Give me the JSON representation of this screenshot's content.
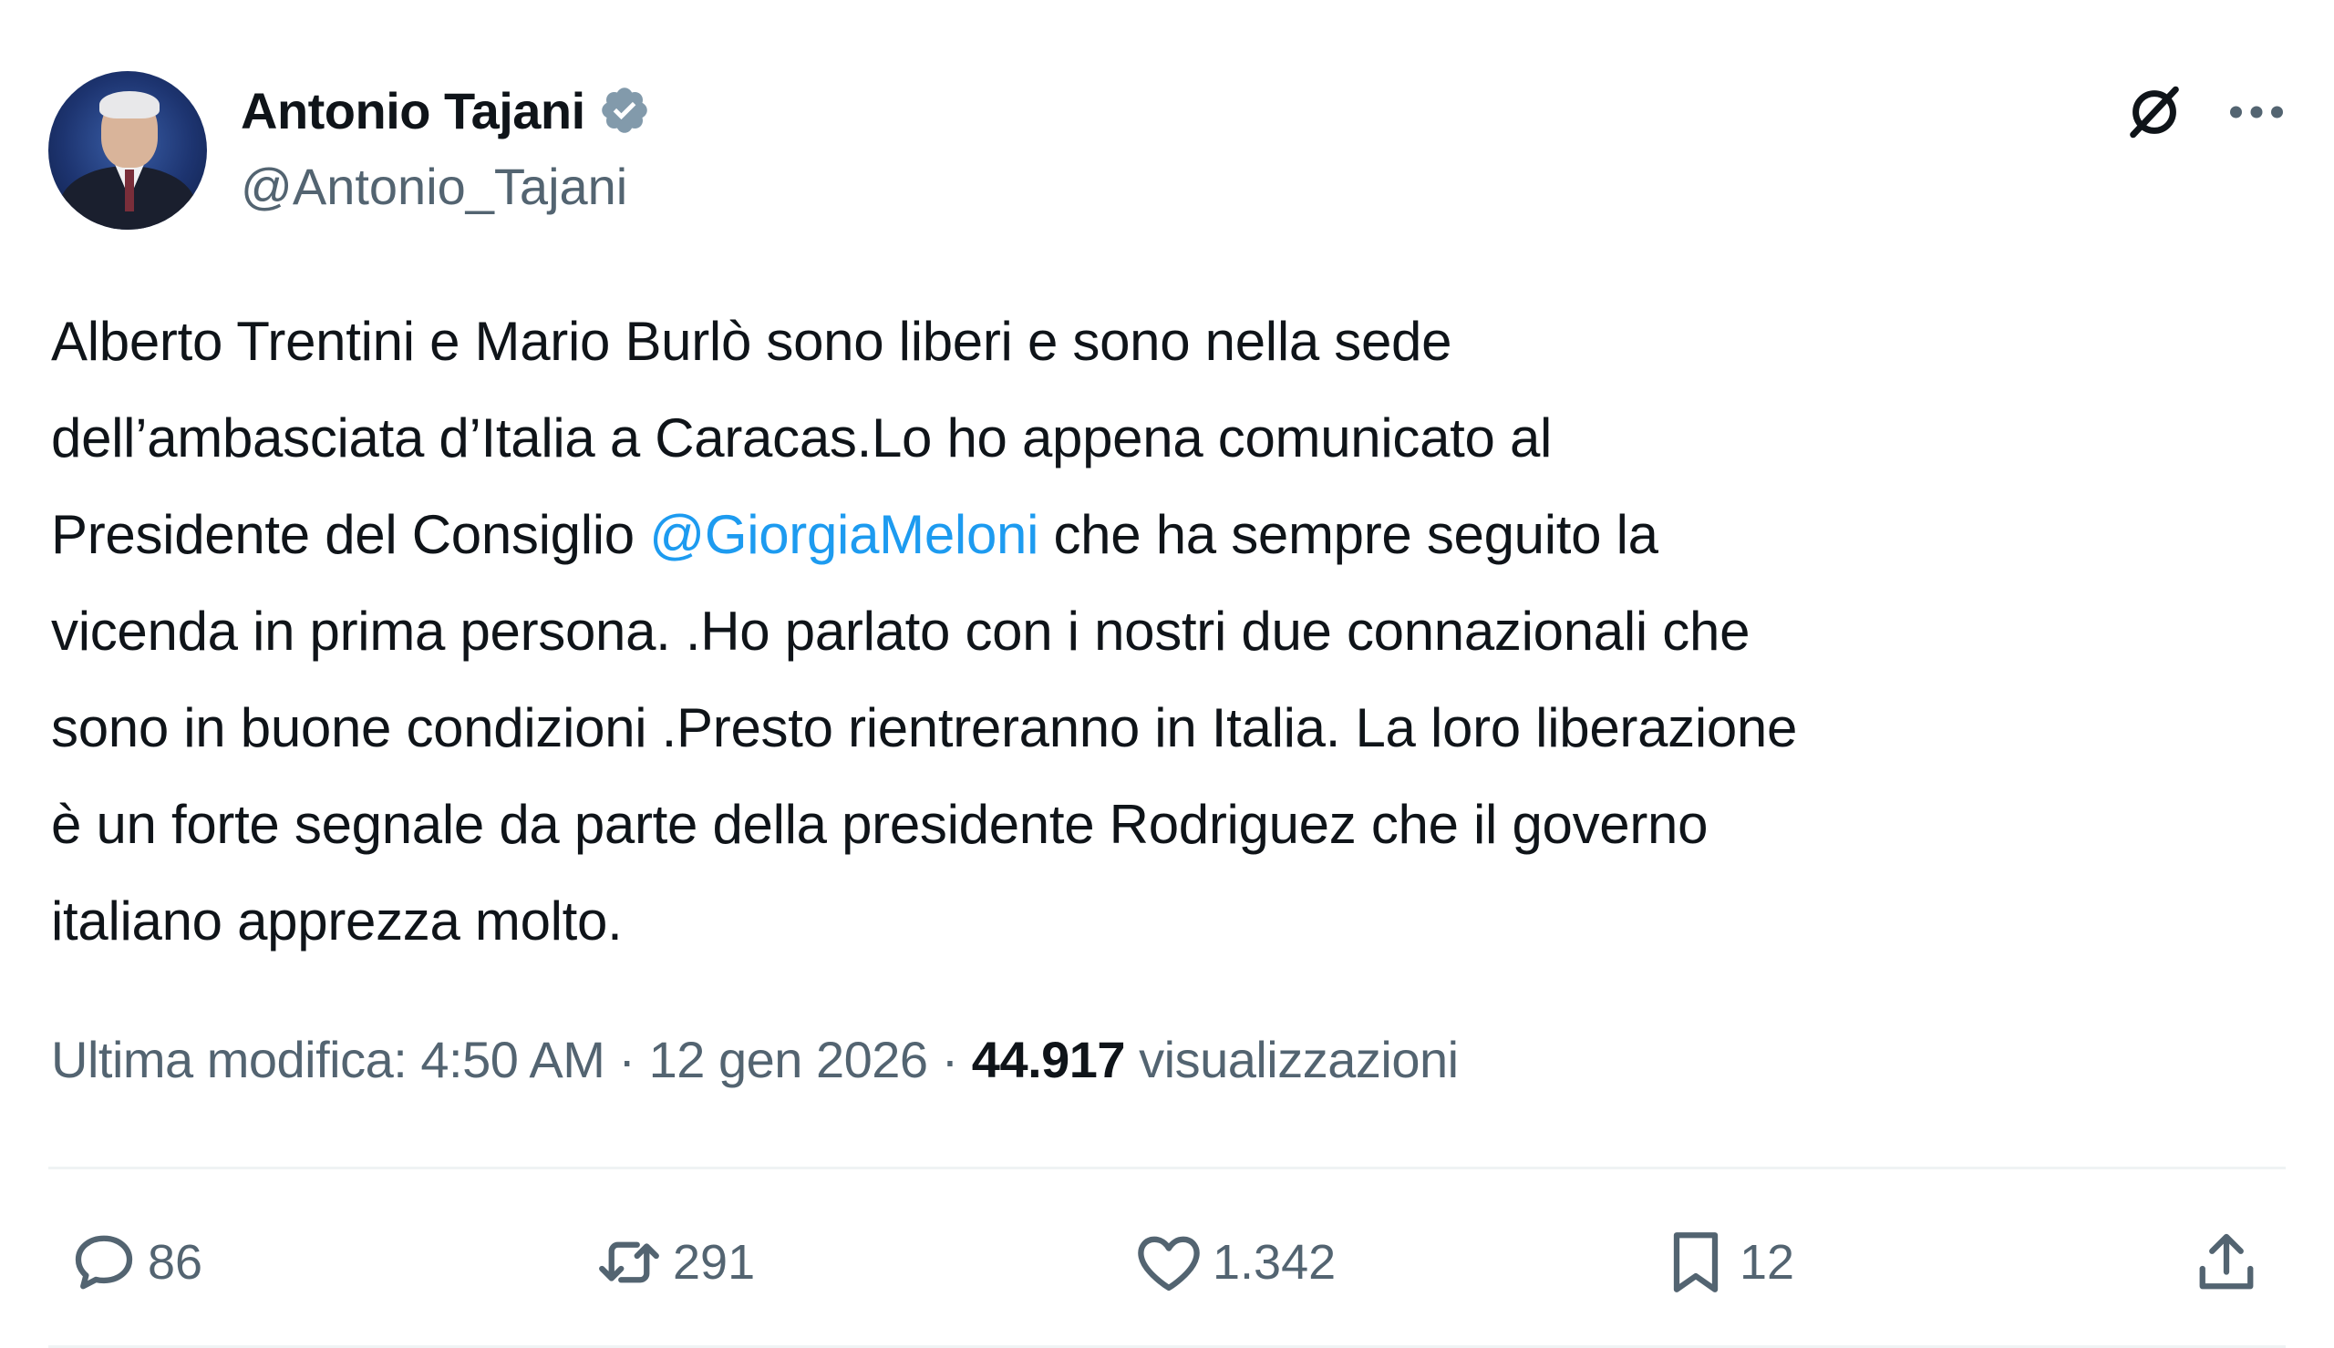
{
  "author": {
    "display_name": "Antonio Tajani",
    "handle": "@Antonio_Tajani",
    "verified_icon": "verified-badge-icon",
    "verified_color": "#829aab"
  },
  "header_actions": {
    "grok_icon": "grok-icon",
    "more_icon": "more-dots-icon"
  },
  "tweet": {
    "text_part1": "Alberto Trentini e Mario Burlò sono liberi e sono nella sede\ndell’ambasciata d’Italia a Caracas.Lo ho appena comunicato al\nPresidente del Consiglio ",
    "mention": "@GiorgiaMeloni",
    "text_part2": " che ha sempre seguito la\nvicenda in prima persona. .Ho parlato con i nostri due connazionali che\nsono in buone condizioni .Presto rientreranno in Italia. La loro liberazione\nè un forte segnale da parte della presidente Rodriguez che il governo\nitaliano apprezza molto.",
    "mention_color": "#1d9bf0"
  },
  "meta": {
    "edited_label": "Ultima modifica: 4:50 AM · 12 gen 2026 · ",
    "views_count": "44.917",
    "views_label": " visualizzazioni"
  },
  "actions": {
    "reply": {
      "icon": "reply-icon",
      "count": "86"
    },
    "repost": {
      "icon": "repost-icon",
      "count": "291"
    },
    "like": {
      "icon": "heart-icon",
      "count": "1.342"
    },
    "bookmark": {
      "icon": "bookmark-icon",
      "count": "12"
    },
    "share": {
      "icon": "share-icon"
    }
  },
  "colors": {
    "text_primary": "#0f1419",
    "text_secondary": "#536471",
    "divider": "#eff3f4"
  }
}
